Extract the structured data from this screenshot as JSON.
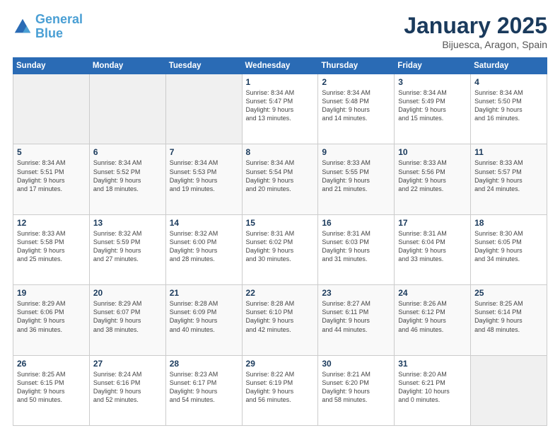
{
  "logo": {
    "line1": "General",
    "line2": "Blue"
  },
  "title": "January 2025",
  "subtitle": "Bijuesca, Aragon, Spain",
  "weekdays": [
    "Sunday",
    "Monday",
    "Tuesday",
    "Wednesday",
    "Thursday",
    "Friday",
    "Saturday"
  ],
  "weeks": [
    [
      {
        "day": "",
        "info": ""
      },
      {
        "day": "",
        "info": ""
      },
      {
        "day": "",
        "info": ""
      },
      {
        "day": "1",
        "info": "Sunrise: 8:34 AM\nSunset: 5:47 PM\nDaylight: 9 hours\nand 13 minutes."
      },
      {
        "day": "2",
        "info": "Sunrise: 8:34 AM\nSunset: 5:48 PM\nDaylight: 9 hours\nand 14 minutes."
      },
      {
        "day": "3",
        "info": "Sunrise: 8:34 AM\nSunset: 5:49 PM\nDaylight: 9 hours\nand 15 minutes."
      },
      {
        "day": "4",
        "info": "Sunrise: 8:34 AM\nSunset: 5:50 PM\nDaylight: 9 hours\nand 16 minutes."
      }
    ],
    [
      {
        "day": "5",
        "info": "Sunrise: 8:34 AM\nSunset: 5:51 PM\nDaylight: 9 hours\nand 17 minutes."
      },
      {
        "day": "6",
        "info": "Sunrise: 8:34 AM\nSunset: 5:52 PM\nDaylight: 9 hours\nand 18 minutes."
      },
      {
        "day": "7",
        "info": "Sunrise: 8:34 AM\nSunset: 5:53 PM\nDaylight: 9 hours\nand 19 minutes."
      },
      {
        "day": "8",
        "info": "Sunrise: 8:34 AM\nSunset: 5:54 PM\nDaylight: 9 hours\nand 20 minutes."
      },
      {
        "day": "9",
        "info": "Sunrise: 8:33 AM\nSunset: 5:55 PM\nDaylight: 9 hours\nand 21 minutes."
      },
      {
        "day": "10",
        "info": "Sunrise: 8:33 AM\nSunset: 5:56 PM\nDaylight: 9 hours\nand 22 minutes."
      },
      {
        "day": "11",
        "info": "Sunrise: 8:33 AM\nSunset: 5:57 PM\nDaylight: 9 hours\nand 24 minutes."
      }
    ],
    [
      {
        "day": "12",
        "info": "Sunrise: 8:33 AM\nSunset: 5:58 PM\nDaylight: 9 hours\nand 25 minutes."
      },
      {
        "day": "13",
        "info": "Sunrise: 8:32 AM\nSunset: 5:59 PM\nDaylight: 9 hours\nand 27 minutes."
      },
      {
        "day": "14",
        "info": "Sunrise: 8:32 AM\nSunset: 6:00 PM\nDaylight: 9 hours\nand 28 minutes."
      },
      {
        "day": "15",
        "info": "Sunrise: 8:31 AM\nSunset: 6:02 PM\nDaylight: 9 hours\nand 30 minutes."
      },
      {
        "day": "16",
        "info": "Sunrise: 8:31 AM\nSunset: 6:03 PM\nDaylight: 9 hours\nand 31 minutes."
      },
      {
        "day": "17",
        "info": "Sunrise: 8:31 AM\nSunset: 6:04 PM\nDaylight: 9 hours\nand 33 minutes."
      },
      {
        "day": "18",
        "info": "Sunrise: 8:30 AM\nSunset: 6:05 PM\nDaylight: 9 hours\nand 34 minutes."
      }
    ],
    [
      {
        "day": "19",
        "info": "Sunrise: 8:29 AM\nSunset: 6:06 PM\nDaylight: 9 hours\nand 36 minutes."
      },
      {
        "day": "20",
        "info": "Sunrise: 8:29 AM\nSunset: 6:07 PM\nDaylight: 9 hours\nand 38 minutes."
      },
      {
        "day": "21",
        "info": "Sunrise: 8:28 AM\nSunset: 6:09 PM\nDaylight: 9 hours\nand 40 minutes."
      },
      {
        "day": "22",
        "info": "Sunrise: 8:28 AM\nSunset: 6:10 PM\nDaylight: 9 hours\nand 42 minutes."
      },
      {
        "day": "23",
        "info": "Sunrise: 8:27 AM\nSunset: 6:11 PM\nDaylight: 9 hours\nand 44 minutes."
      },
      {
        "day": "24",
        "info": "Sunrise: 8:26 AM\nSunset: 6:12 PM\nDaylight: 9 hours\nand 46 minutes."
      },
      {
        "day": "25",
        "info": "Sunrise: 8:25 AM\nSunset: 6:14 PM\nDaylight: 9 hours\nand 48 minutes."
      }
    ],
    [
      {
        "day": "26",
        "info": "Sunrise: 8:25 AM\nSunset: 6:15 PM\nDaylight: 9 hours\nand 50 minutes."
      },
      {
        "day": "27",
        "info": "Sunrise: 8:24 AM\nSunset: 6:16 PM\nDaylight: 9 hours\nand 52 minutes."
      },
      {
        "day": "28",
        "info": "Sunrise: 8:23 AM\nSunset: 6:17 PM\nDaylight: 9 hours\nand 54 minutes."
      },
      {
        "day": "29",
        "info": "Sunrise: 8:22 AM\nSunset: 6:19 PM\nDaylight: 9 hours\nand 56 minutes."
      },
      {
        "day": "30",
        "info": "Sunrise: 8:21 AM\nSunset: 6:20 PM\nDaylight: 9 hours\nand 58 minutes."
      },
      {
        "day": "31",
        "info": "Sunrise: 8:20 AM\nSunset: 6:21 PM\nDaylight: 10 hours\nand 0 minutes."
      },
      {
        "day": "",
        "info": ""
      }
    ]
  ]
}
